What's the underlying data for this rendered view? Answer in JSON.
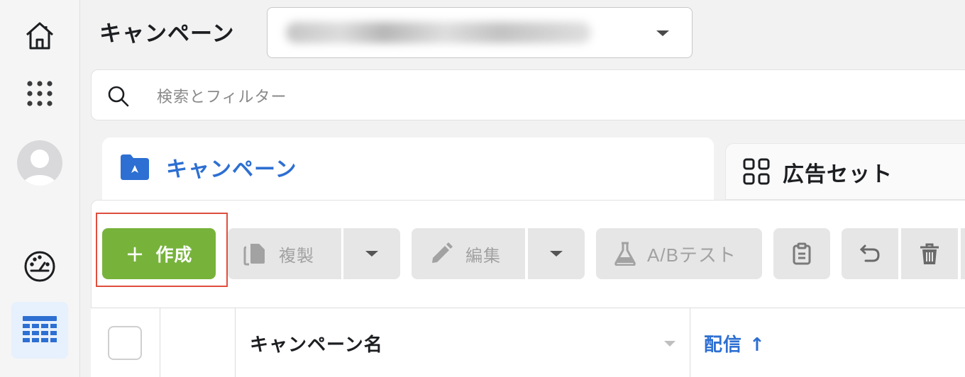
{
  "header": {
    "title": "キャンペーン",
    "account_select": {
      "value": ""
    }
  },
  "search": {
    "placeholder": "検索とフィルター"
  },
  "tabs": [
    {
      "label": "キャンペーン",
      "icon": "folder-icon",
      "active": true
    },
    {
      "label": "広告セット",
      "icon": "grid-icon",
      "active": false
    }
  ],
  "toolbar": {
    "create_label": "作成",
    "duplicate_label": "複製",
    "edit_label": "編集",
    "ab_test_label": "A/Bテスト"
  },
  "table": {
    "columns": [
      {
        "label": "キャンペーン名"
      },
      {
        "label": "配信 ↑"
      }
    ]
  },
  "colors": {
    "accent": "#2d6fd2",
    "create": "#77b33b",
    "highlight": "#e04e3e"
  }
}
